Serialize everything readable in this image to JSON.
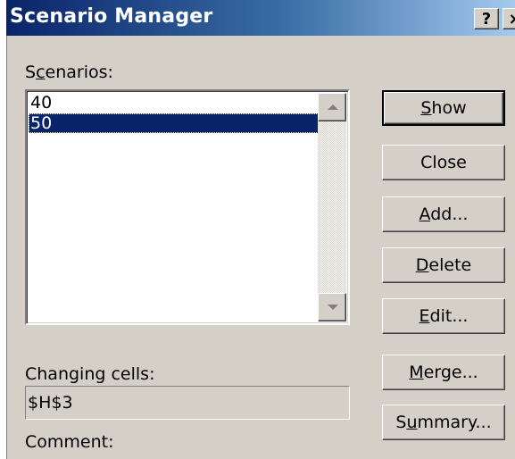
{
  "window": {
    "title": "Scenario Manager",
    "help_glyph": "?",
    "close_glyph": "×"
  },
  "scenarios": {
    "label_pre": "S",
    "label_mn": "c",
    "label_post": "enarios:",
    "items": [
      "40",
      "50"
    ],
    "selected_index": 1
  },
  "buttons": {
    "show": {
      "mn": "S",
      "rest": "how"
    },
    "close": {
      "label": "Close"
    },
    "add": {
      "mn": "A",
      "rest": "dd..."
    },
    "delete": {
      "mn": "D",
      "rest": "elete"
    },
    "edit": {
      "mn": "E",
      "rest": "dit..."
    },
    "merge": {
      "mn": "M",
      "rest": "erge..."
    },
    "summary": {
      "pre": "S",
      "mn": "u",
      "rest": "mmary..."
    }
  },
  "changing_cells": {
    "label": "Changing cells:",
    "value": "$H$3"
  },
  "comment": {
    "label": "Comment:"
  },
  "colors": {
    "titlebar_start": "#0a246a",
    "titlebar_end": "#a6caf0",
    "dialog_face": "#d4d0c8",
    "selection": "#0a246a"
  }
}
